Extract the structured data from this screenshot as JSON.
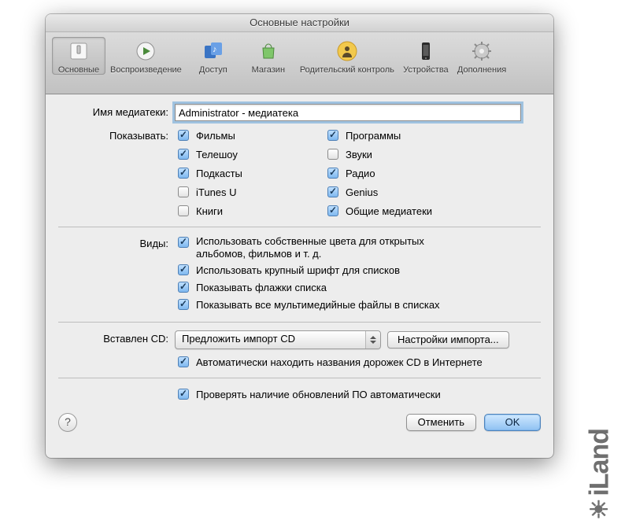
{
  "window": {
    "title": "Основные настройки"
  },
  "toolbar": {
    "items": [
      {
        "label": "Основные",
        "icon": "switch",
        "selected": true
      },
      {
        "label": "Воспроизведение",
        "icon": "play",
        "selected": false
      },
      {
        "label": "Доступ",
        "icon": "share",
        "selected": false
      },
      {
        "label": "Магазин",
        "icon": "bag",
        "selected": false
      },
      {
        "label": "Родительский контроль",
        "icon": "person",
        "selected": false
      },
      {
        "label": "Устройства",
        "icon": "phone",
        "selected": false
      },
      {
        "label": "Дополнения",
        "icon": "gear",
        "selected": false
      }
    ]
  },
  "labels": {
    "library_name": "Имя медиатеки:",
    "show": "Показывать:",
    "views": "Виды:",
    "cd_inserted": "Вставлен CD:"
  },
  "library_name_value": "Administrator - медиатека",
  "show_options": {
    "left": [
      {
        "label": "Фильмы",
        "checked": true
      },
      {
        "label": "Телешоу",
        "checked": true
      },
      {
        "label": "Подкасты",
        "checked": true
      },
      {
        "label": "iTunes U",
        "checked": false
      },
      {
        "label": "Книги",
        "checked": false
      }
    ],
    "right": [
      {
        "label": "Программы",
        "checked": true
      },
      {
        "label": "Звуки",
        "checked": false
      },
      {
        "label": "Радио",
        "checked": true
      },
      {
        "label": "Genius",
        "checked": true
      },
      {
        "label": "Общие медиатеки",
        "checked": true
      }
    ]
  },
  "views_options": [
    {
      "label": "Использовать собственные цвета для открытых альбомов, фильмов и т. д.",
      "checked": true
    },
    {
      "label": "Использовать крупный шрифт для списков",
      "checked": true
    },
    {
      "label": "Показывать флажки списка",
      "checked": true
    },
    {
      "label": "Показывать все мультимедийные файлы в списках",
      "checked": true
    }
  ],
  "cd": {
    "select_value": "Предложить импорт CD",
    "settings_button": "Настройки импорта...",
    "auto_lookup": {
      "label": "Автоматически находить названия дорожек CD в Интернете",
      "checked": true
    }
  },
  "updates": {
    "label": "Проверять наличие обновлений ПО автоматически",
    "checked": true
  },
  "buttons": {
    "cancel": "Отменить",
    "ok": "OK"
  },
  "watermark": "iLand"
}
